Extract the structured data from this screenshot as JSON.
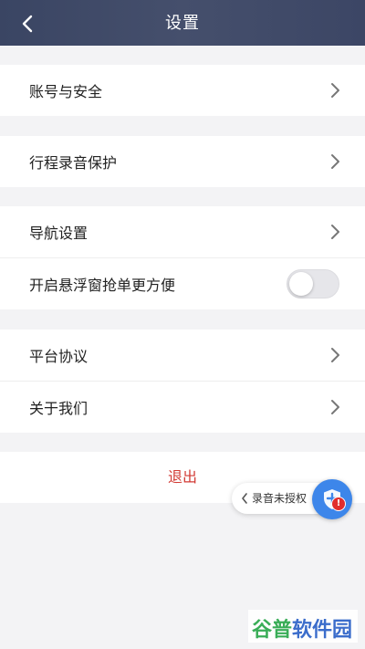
{
  "header": {
    "title": "设置"
  },
  "groups": {
    "account": {
      "label": "账号与安全"
    },
    "trip": {
      "label": "行程录音保护"
    },
    "navigation": {
      "label": "导航设置"
    },
    "floating": {
      "label": "开启悬浮窗抢单更方便",
      "enabled": false
    },
    "platform": {
      "label": "平台协议"
    },
    "about": {
      "label": "关于我们"
    }
  },
  "logout": {
    "label": "退出",
    "color": "#d23a34"
  },
  "float_widget": {
    "label": "录音未授权",
    "badge": "!"
  },
  "watermark": {
    "text_a": "谷普",
    "text_b": "软件园"
  },
  "colors": {
    "header_bg": "#3f4968",
    "accent": "#3d86ea",
    "danger": "#d23a34"
  }
}
